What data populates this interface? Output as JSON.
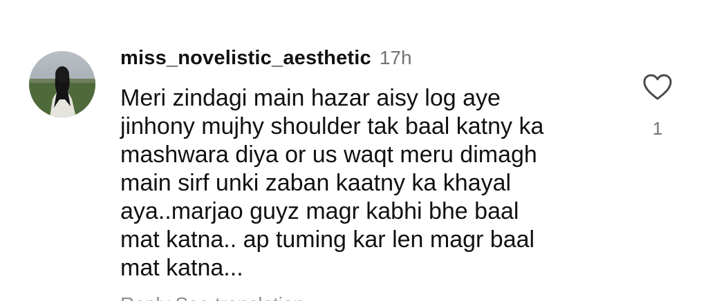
{
  "comment": {
    "username": "miss_novelistic_aesthetic",
    "timestamp": "17h",
    "text": "Meri zindagi main hazar aisy log aye\njinhony mujhy shoulder tak baal katny ka\nmashwara diya or us waqt meru dimagh\nmain sirf unki zaban kaatny ka khayal\naya..marjao guyz magr kabhi bhe baal\nmat katna.. ap tuming kar len magr baal\nmat katna...",
    "like_icon": "heart-outline-icon",
    "like_count": "1",
    "footer_partial": "Reply   See translation"
  },
  "colors": {
    "text": "#111111",
    "muted": "#737373",
    "background": "#ffffff"
  }
}
